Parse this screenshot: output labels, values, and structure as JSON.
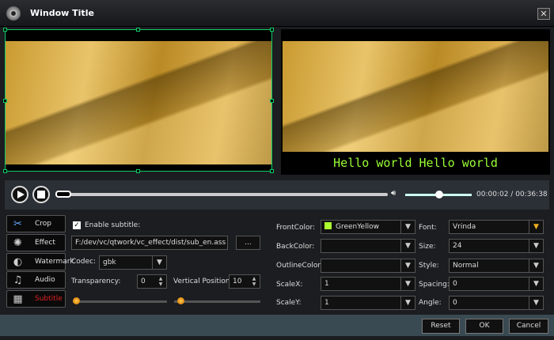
{
  "window": {
    "title": "Window Title",
    "close": "✕"
  },
  "preview": {
    "subtitle_text": "Hello world Hello world"
  },
  "player": {
    "current_time": "00:00:02",
    "separator": "/",
    "total_time": "00:36:38",
    "progress": 0.01,
    "volume": 0.5
  },
  "tabs": [
    {
      "label": "Crop",
      "icon": "scissors-icon"
    },
    {
      "label": "Effect",
      "icon": "sun-icon"
    },
    {
      "label": "Watermark",
      "icon": "watermark-icon"
    },
    {
      "label": "Audio",
      "icon": "music-icon"
    },
    {
      "label": "Subtitle",
      "icon": "film-icon",
      "active": true
    }
  ],
  "subtitle": {
    "enable_label": "Enable subtitle:",
    "enabled": true,
    "file_path": "F:/dev/vc/qtwork/vc_effect/dist/sub_en.ass",
    "browse_label": "...",
    "codec_label": "Codec:",
    "codec": "gbk",
    "transparency_label": "Transparency:",
    "transparency": "0",
    "vpos_label": "Vertical Position:",
    "vpos": "10"
  },
  "style": {
    "front_label": "FrontColor:",
    "front": "GreenYellow",
    "front_swatch": "#adff2f",
    "back_label": "BackColor:",
    "back": "",
    "outline_label": "OutlineColor:",
    "outline": "",
    "scalex_label": "ScaleX:",
    "scalex": "1",
    "scaley_label": "ScaleY:",
    "scaley": "1",
    "font_label": "Font:",
    "font": "Vrinda",
    "size_label": "Size:",
    "size": "24",
    "style_label": "Style:",
    "style": "Normal",
    "spacing_label": "Spacing:",
    "spacing": "0",
    "angle_label": "Angle:",
    "angle": "0"
  },
  "footer": {
    "reset": "Reset",
    "ok": "OK",
    "cancel": "Cancel"
  },
  "colors": {
    "active_tab": "#e02020",
    "subtitle": "#99ff33"
  }
}
